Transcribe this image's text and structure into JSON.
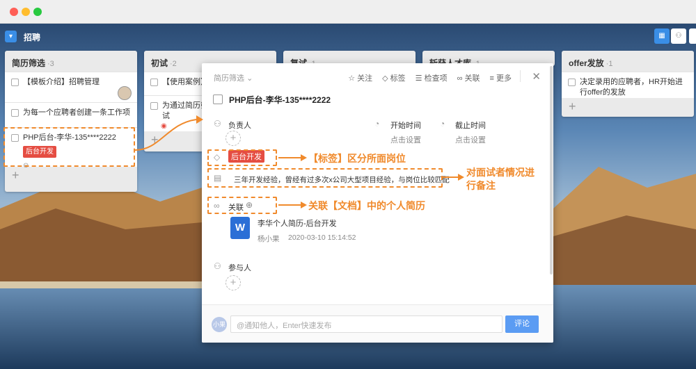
{
  "window": {
    "traffic_colors": [
      "#ff5f57",
      "#ffbd2e",
      "#28c940"
    ]
  },
  "app": {
    "project_title": "招聘",
    "menu_icon": "chevron-down-icon",
    "view_icons": [
      "board-icon",
      "people-icon"
    ]
  },
  "columns": [
    {
      "title": "简历筛选",
      "count": "·3",
      "cards": [
        "【模板介绍】招聘管理",
        "为每一个应聘者创建一条工作项",
        "PHP后台-李华-135****2222"
      ],
      "card_tag": "后台开发"
    },
    {
      "title": "初试",
      "count": "·2",
      "cards": [
        "【使用案例】招聘管理",
        "为通过简历筛选的应聘者安排初试"
      ]
    },
    {
      "title": "复试",
      "count": "·1"
    },
    {
      "title": "斩获人才库",
      "count": "·1"
    },
    {
      "title": "offer发放",
      "count": "·1",
      "cards": [
        "决定录用的应聘者，HR开始进行offer的发放"
      ]
    }
  ],
  "panel": {
    "breadcrumb": "简历筛选",
    "actions": [
      "关注",
      "标签",
      "检查项",
      "关联",
      "更多"
    ],
    "task_title": "PHP后台-李华-135****2222",
    "assignee_label": "负责人",
    "start_label": "开始时间",
    "start_value": "点击设置",
    "due_label": "截止时间",
    "due_value": "点击设置",
    "tag": "后台开发",
    "note": "三年开发经验，曾经有过多次x公司大型项目经验，与岗位比较匹配",
    "link_label": "关联",
    "doc_name": "李华个人简历-后台开发",
    "doc_author": "杨小果",
    "doc_time": "2020-03-10 15:14:52",
    "participants_label": "参与人",
    "composer_avatar": "小果",
    "composer_placeholder": "@通知他人，Enter快速发布",
    "composer_button": "评论"
  },
  "annotations": {
    "tag": "【标签】区分所面岗位",
    "note_line1": "对面试者情况进",
    "note_line2": "行备注",
    "link": "关联【文档】中的个人简历"
  },
  "colors": {
    "accent": "#3a8ee6",
    "annotation": "#f08a2c",
    "tag_red": "#e54d42",
    "comment_btn": "#5b9cf3"
  }
}
